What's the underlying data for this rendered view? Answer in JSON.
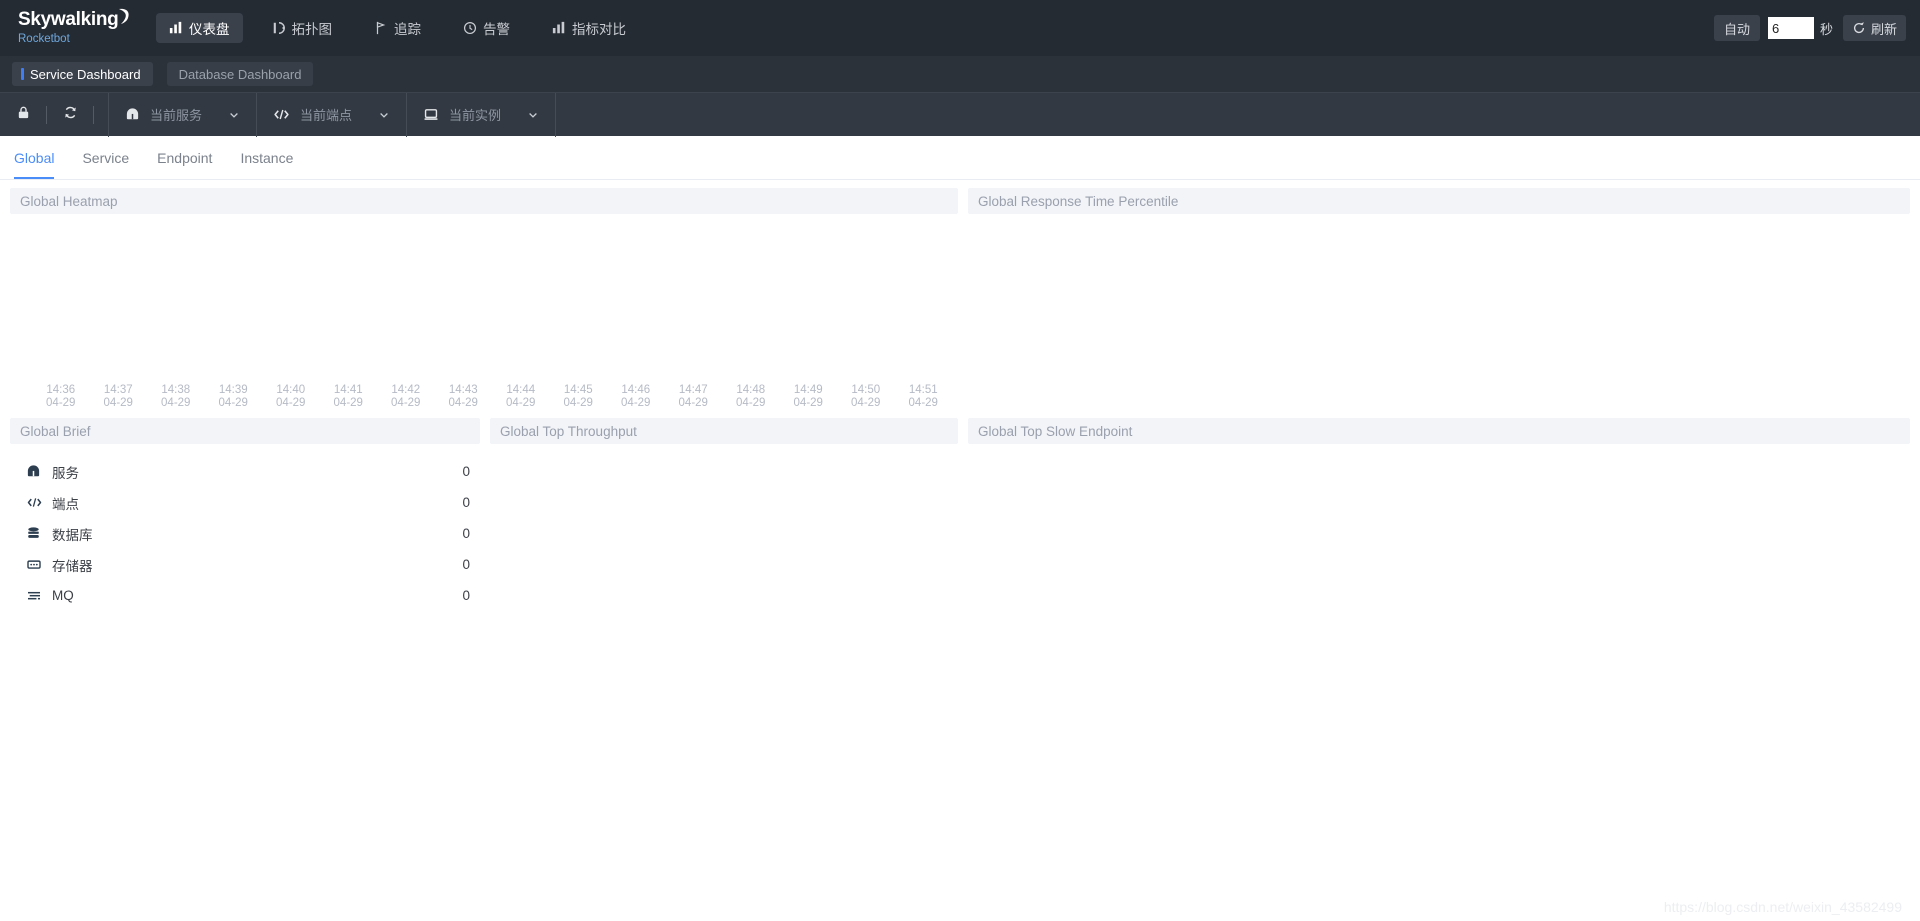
{
  "header": {
    "logo_main": "Skywalking",
    "logo_sub": "Rocketbot",
    "nav": [
      {
        "label": "仪表盘",
        "icon": "dashboard-icon",
        "active": true
      },
      {
        "label": "拓扑图",
        "icon": "topology-icon",
        "active": false
      },
      {
        "label": "追踪",
        "icon": "trace-icon",
        "active": false
      },
      {
        "label": "告警",
        "icon": "alarm-icon",
        "active": false
      },
      {
        "label": "指标对比",
        "icon": "compare-icon",
        "active": false
      }
    ],
    "auto_label": "自动",
    "auto_value": "6",
    "seconds_label": "秒",
    "refresh_label": "刷新",
    "refresh_icon": "refresh-icon"
  },
  "dashboard_tabs": [
    {
      "label": "Service Dashboard",
      "active": true
    },
    {
      "label": "Database Dashboard",
      "active": false
    }
  ],
  "toolbar": {
    "lock_icon": "lock-icon",
    "reload_icon": "reload-icon",
    "selectors": [
      {
        "icon": "service-icon",
        "label": "当前服务",
        "caret": "chevron-down-icon"
      },
      {
        "icon": "endpoint-icon",
        "label": "当前端点",
        "caret": "chevron-down-icon"
      },
      {
        "icon": "instance-icon",
        "label": "当前实例",
        "caret": "chevron-down-icon"
      }
    ]
  },
  "subtabs": [
    {
      "label": "Global",
      "active": true
    },
    {
      "label": "Service",
      "active": false
    },
    {
      "label": "Endpoint",
      "active": false
    },
    {
      "label": "Instance",
      "active": false
    }
  ],
  "panels": {
    "heatmap": {
      "title": "Global Heatmap"
    },
    "percentile": {
      "title": "Global Response Time Percentile"
    },
    "brief": {
      "title": "Global Brief"
    },
    "top_throughput": {
      "title": "Global Top Throughput"
    },
    "top_slow_endpoint": {
      "title": "Global Top Slow Endpoint"
    }
  },
  "chart_data": {
    "type": "heatmap",
    "title": "Global Heatmap",
    "xlabel": "",
    "ylabel": "",
    "grid": false,
    "legend": "none",
    "x_tick_times": [
      "14:36",
      "14:37",
      "14:38",
      "14:39",
      "14:40",
      "14:41",
      "14:42",
      "14:43",
      "14:44",
      "14:45",
      "14:46",
      "14:47",
      "14:48",
      "14:49",
      "14:50",
      "14:51"
    ],
    "x_tick_dates": [
      "04-29",
      "04-29",
      "04-29",
      "04-29",
      "04-29",
      "04-29",
      "04-29",
      "04-29",
      "04-29",
      "04-29",
      "04-29",
      "04-29",
      "04-29",
      "04-29",
      "04-29",
      "04-29"
    ],
    "values": [],
    "note": "no data rendered"
  },
  "global_brief": {
    "columns": [
      "name",
      "value"
    ],
    "rows": [
      {
        "icon": "service-icon",
        "label": "服务",
        "value": "0"
      },
      {
        "icon": "endpoint-icon",
        "label": "端点",
        "value": "0"
      },
      {
        "icon": "database-icon",
        "label": "数据库",
        "value": "0"
      },
      {
        "icon": "cache-icon",
        "label": "存储器",
        "value": "0"
      },
      {
        "icon": "mq-icon",
        "label": "MQ",
        "value": "0"
      }
    ]
  },
  "watermark": "https://blog.csdn.net/weixin_43582499",
  "colors": {
    "header_bg": "#252b33",
    "tabs_bg": "#2c323a",
    "toolbar_bg": "#333942",
    "accent_blue": "#4a8df8",
    "panel_head_bg": "#f2f4f8"
  }
}
